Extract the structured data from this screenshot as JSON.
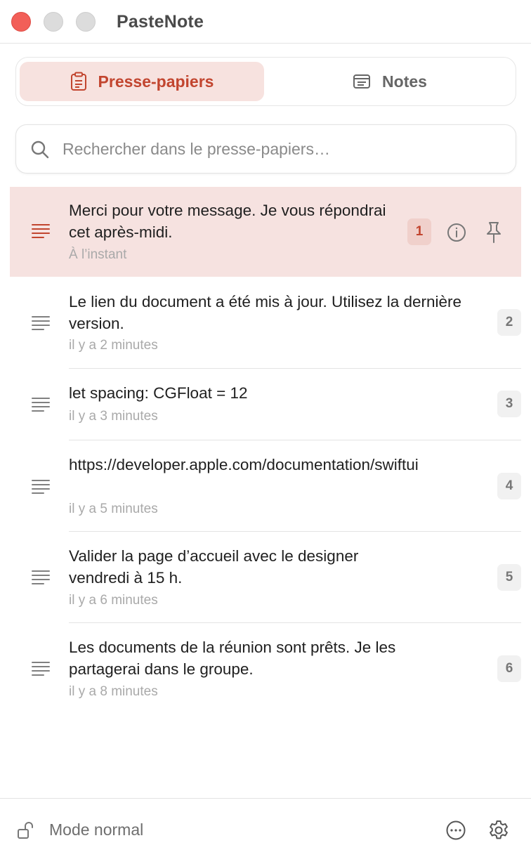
{
  "window": {
    "title": "PasteNote"
  },
  "tabs": [
    {
      "label": "Presse-papiers",
      "icon": "clipboard-icon",
      "active": true
    },
    {
      "label": "Notes",
      "icon": "note-icon",
      "active": false
    }
  ],
  "search": {
    "placeholder": "Rechercher dans le presse-papiers…",
    "value": ""
  },
  "items": [
    {
      "text": "Merci pour votre message. Je vous répondrai cet après-midi.",
      "time": "À l’instant",
      "index": "1",
      "selected": true
    },
    {
      "text": "Le lien du document a été mis à jour. Utilisez la dernière version.",
      "time": "il y a 2 minutes",
      "index": "2"
    },
    {
      "text": "let spacing: CGFloat = 12",
      "time": "il y a 3 minutes",
      "index": "3"
    },
    {
      "text": "https://developer.apple.com/documentation/swiftui",
      "time": "il y a 5 minutes",
      "index": "4"
    },
    {
      "text": "Valider la page d’accueil avec le designer vendredi à 15 h.",
      "time": "il y a 6 minutes",
      "index": "5"
    },
    {
      "text": "Les documents de la réunion sont prêts. Je les partagerai dans le groupe.",
      "time": "il y a 8 minutes",
      "index": "6"
    }
  ],
  "footer": {
    "mode_label": "Mode normal"
  },
  "colors": {
    "accent": "#c2452f",
    "selected_bg": "#f6e2e0",
    "close": "#f25f58"
  }
}
